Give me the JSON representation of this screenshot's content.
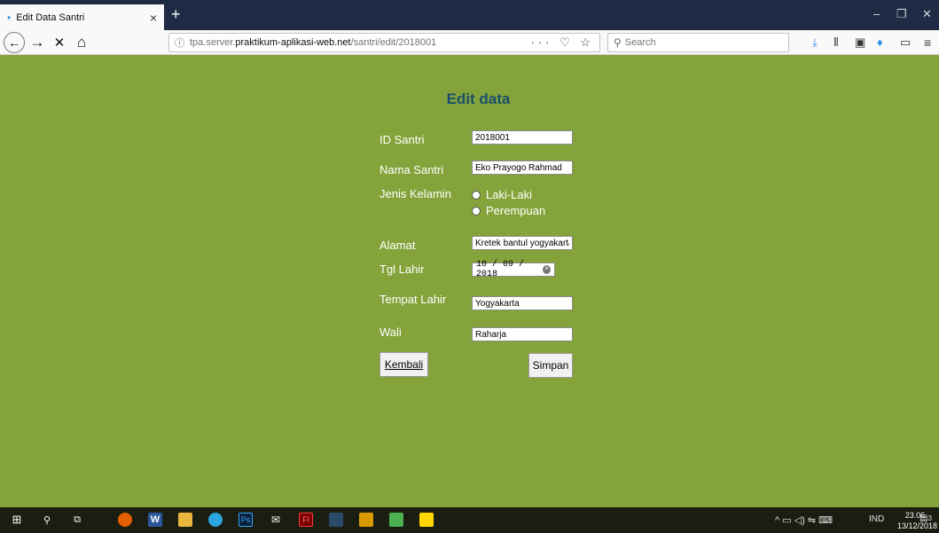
{
  "browser": {
    "tab_title": "Edit Data Santri",
    "tab_bullet": "•",
    "tab_close": "×",
    "new_tab": "+",
    "win_min": "–",
    "win_restore": "❐",
    "win_close": "✕",
    "nav_back": "←",
    "nav_forward": "→",
    "nav_stop": "✕",
    "nav_home": "⌂",
    "url_info": "ⓘ",
    "url_prefix": "tpa.server.",
    "url_domain": "praktikum-aplikasi-web.net",
    "url_path": "/santri/edit/2018001",
    "url_actions": "··· ♡ ☆",
    "search_placeholder": "Search",
    "tool_download": "⤓",
    "tool_library": "⦀",
    "tool_sidebar": "▣",
    "tool_pocket": "♦",
    "tool_screenshot": "▭",
    "tool_menu": "≡",
    "accent": "#2f8fe8"
  },
  "page": {
    "title": "Edit data",
    "background": "#84a43b",
    "title_color": "#1a4f6b"
  },
  "form": {
    "id_label": "ID Santri",
    "id_value": "2018001",
    "nama_label": "Nama Santri",
    "nama_value": "Eko Prayogo Rahmad",
    "jk_label": "Jenis Kelamin",
    "jk_options": [
      "Laki-Laki",
      "Perempuan"
    ],
    "alamat_label": "Alamat",
    "alamat_value": "Kretek bantul yogyakarta",
    "tgl_label": "Tgl Lahir",
    "tgl_value": "10 / 09 / 2018",
    "tgl_clear": "×",
    "tempat_label": "Tempat Lahir",
    "tempat_value": "Yogyakarta",
    "wali_label": "Wali",
    "wali_value": "Raharja",
    "kembali_label": "Kembali",
    "simpan_label": "Simpan"
  },
  "taskbar": {
    "start": "⊞",
    "search": "⚲",
    "taskview": "⧉",
    "app_word": "W",
    "app_ps": "Ps",
    "app_fl": "Fl",
    "tray_icons": "^ ▭ ◁) ⇋ ⌨",
    "lang": "IND",
    "time": "23.06",
    "date": "13/12/2018",
    "notif": "3"
  }
}
